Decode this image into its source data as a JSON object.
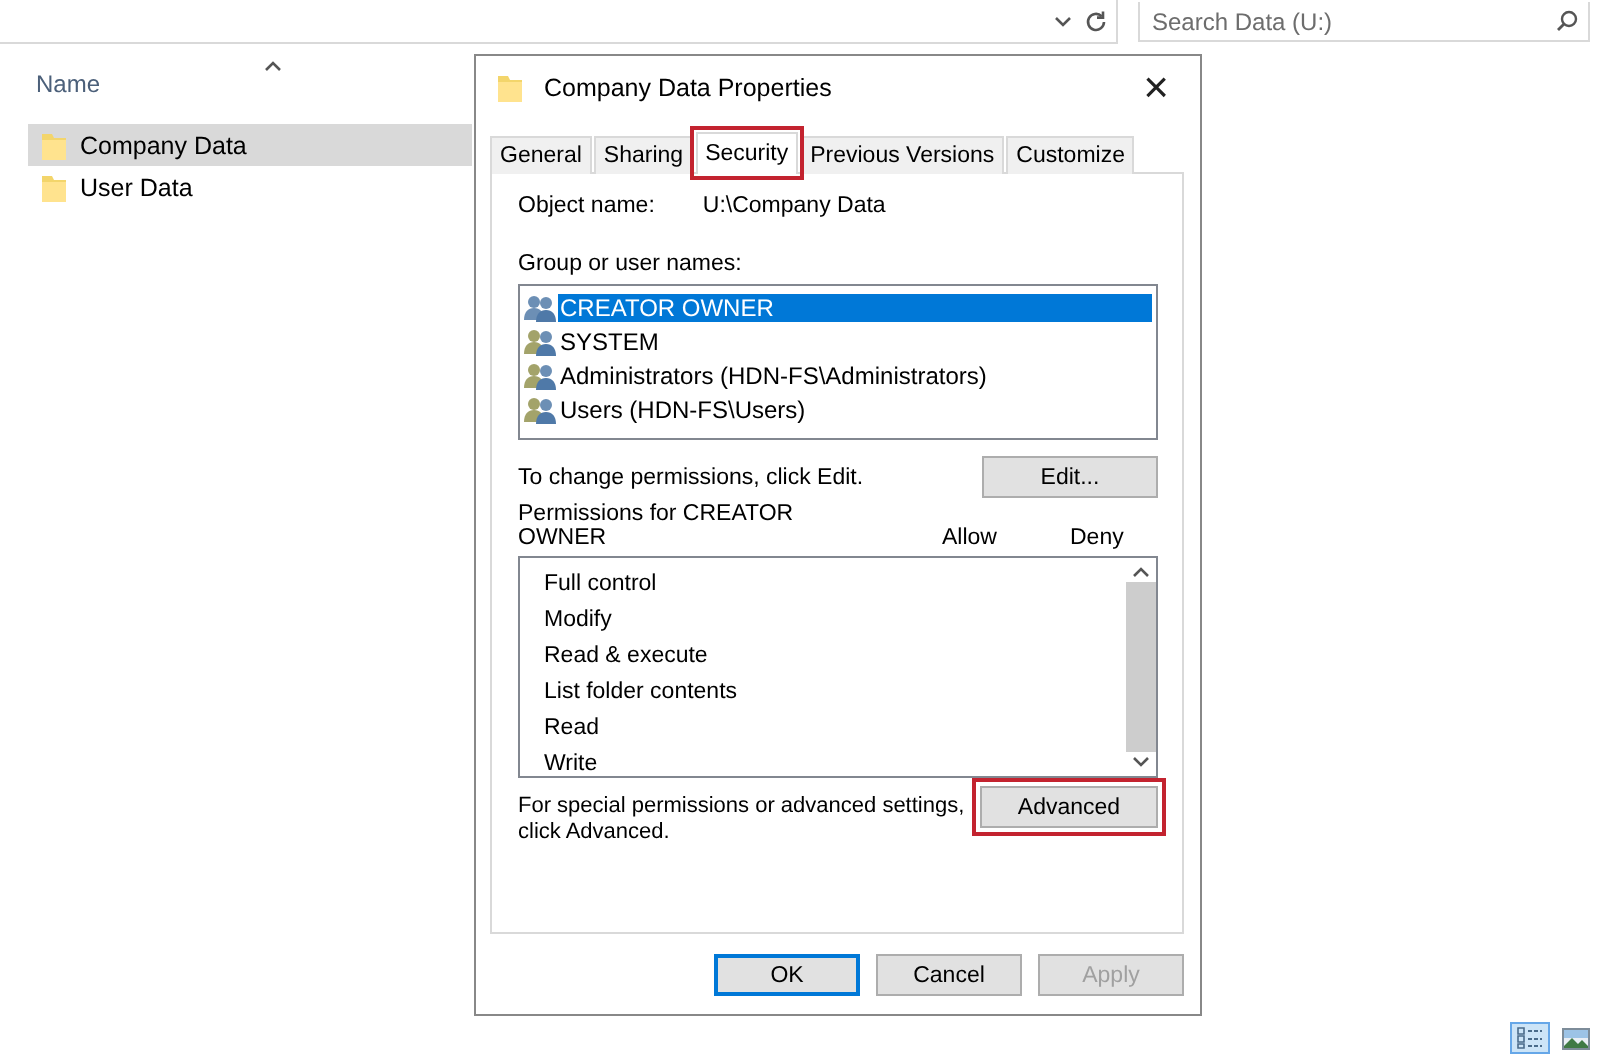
{
  "explorer": {
    "search": {
      "placeholder": "Search Data (U:)"
    },
    "column_header": "Name",
    "files": [
      {
        "name": "Company Data",
        "selected": true
      },
      {
        "name": "User Data",
        "selected": false
      }
    ],
    "views": [
      {
        "kind": "details",
        "selected": true
      },
      {
        "kind": "thumbnails",
        "selected": false
      }
    ]
  },
  "dialog": {
    "title": "Company Data Properties",
    "close": "×",
    "tabs": [
      {
        "label": "General",
        "selected": false,
        "highlighted": false
      },
      {
        "label": "Sharing",
        "selected": false,
        "highlighted": false
      },
      {
        "label": "Security",
        "selected": true,
        "highlighted": true
      },
      {
        "label": "Previous Versions",
        "selected": false,
        "highlighted": false
      },
      {
        "label": "Customize",
        "selected": false,
        "highlighted": false
      }
    ],
    "object_name_label": "Object name:",
    "object_name": "U:\\Company Data",
    "group_label": "Group or user names:",
    "groups": [
      {
        "name": "CREATOR OWNER",
        "selected": true
      },
      {
        "name": "SYSTEM",
        "selected": false
      },
      {
        "name": "Administrators (HDN-FS\\Administrators)",
        "selected": false
      },
      {
        "name": "Users (HDN-FS\\Users)",
        "selected": false
      }
    ],
    "change_hint": "To change permissions, click Edit.",
    "edit_button": {
      "label": "Edit..."
    },
    "permissions_label": "Permissions for CREATOR OWNER",
    "allow_header": "Allow",
    "deny_header": "Deny",
    "permissions": [
      "Full control",
      "Modify",
      "Read & execute",
      "List folder contents",
      "Read",
      "Write"
    ],
    "advanced_hint": "For special permissions or advanced settings, click Advanced.",
    "advanced_button": {
      "label": "Advanced",
      "highlighted": true
    },
    "buttons": [
      {
        "label": "OK",
        "default": true,
        "disabled": false
      },
      {
        "label": "Cancel",
        "default": false,
        "disabled": false
      },
      {
        "label": "Apply",
        "default": false,
        "disabled": true
      }
    ]
  }
}
